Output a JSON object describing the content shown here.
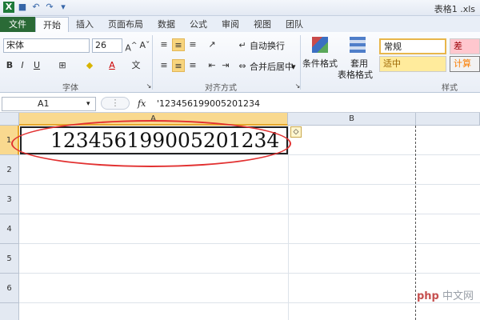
{
  "titlebar": {
    "doc_title": "表格1 .xls"
  },
  "tabs": [
    "文件",
    "开始",
    "插入",
    "页面布局",
    "数据",
    "公式",
    "审阅",
    "视图",
    "团队"
  ],
  "ribbon": {
    "font_name": "宋体",
    "font_size": "26",
    "wrap_text": "自动换行",
    "merge_center": "合并后居中",
    "cond_format": "条件格式",
    "table_format_1": "套用",
    "table_format_2": "表格格式",
    "style_normal": "常规",
    "style_bad": "差",
    "style_neutral": "适中",
    "style_calc": "计算",
    "group_font": "字体",
    "group_align": "对齐方式",
    "group_styles": "样式"
  },
  "formula_bar": {
    "name_box": "A1",
    "fx": "fx",
    "content": "'123456199005201234"
  },
  "grid": {
    "columns": [
      "A",
      "B"
    ],
    "rows": [
      "1",
      "2",
      "3",
      "4",
      "5",
      "6"
    ],
    "cell_A1": "123456199005201234"
  },
  "watermark": {
    "brand": "php",
    "site": "中文网"
  },
  "colors": {
    "file_tab": "#2a6a36",
    "selection": "#f9d98f",
    "ellipse": "#e23131"
  }
}
